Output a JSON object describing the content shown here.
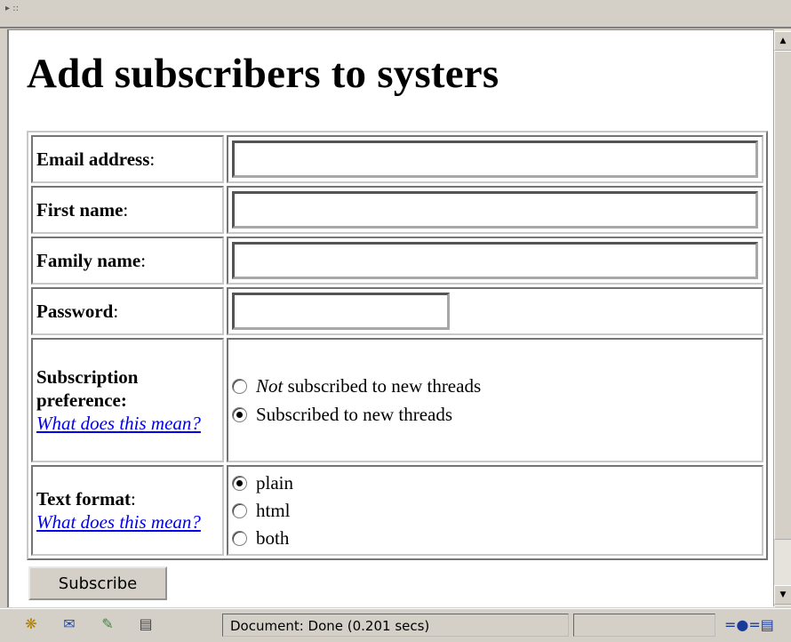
{
  "page": {
    "title": "Add subscribers to systers"
  },
  "form": {
    "email_label": "Email address",
    "first_name_label": "First name",
    "family_name_label": "Family name",
    "password_label": "Password",
    "colon": ":",
    "subscription": {
      "label_line1": "Subscription",
      "label_line2": "preference:",
      "help_link": "What does this mean?",
      "option_not_emph": "Not",
      "option_not_rest": " subscribed to new threads",
      "option_subscribed": "Subscribed to new threads",
      "selected": "Subscribed to new threads"
    },
    "text_format": {
      "label": "Text format",
      "help_link": "What does this mean?",
      "options": [
        "plain",
        "html",
        "both"
      ],
      "selected": "plain"
    },
    "submit_label": "Subscribe"
  },
  "statusbar": {
    "text": "Document: Done (0.201 secs)",
    "icons": [
      "navigator-icon",
      "mail-icon",
      "composer-icon",
      "address-book-icon"
    ]
  },
  "colors": {
    "link": "#0000ee",
    "chrome": "#d4d0c8"
  }
}
